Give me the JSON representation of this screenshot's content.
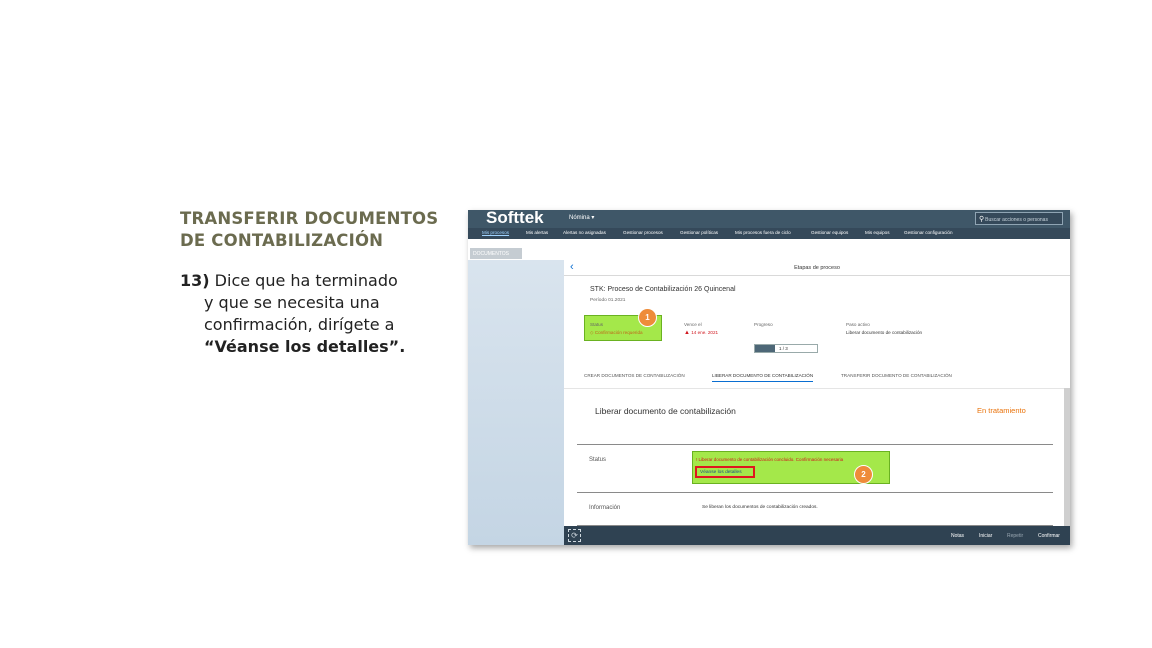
{
  "slide": {
    "title_line1": "TRANSFERIR DOCUMENTOS",
    "title_line2": "DE  CONTABILIZACIÓN",
    "step_number": "13)",
    "step_line1": "Dice que ha terminado",
    "step_line2": "y que se necesita una",
    "step_line3": "confirmación, dirígete a",
    "step_line4": "“Véanse los  detalles”."
  },
  "shell": {
    "logo": "Softtek",
    "app_menu": "Nómina ▾",
    "search_placeholder": "Buscar acciones o personas",
    "nav": [
      "Mis procesos",
      "Mis alertas",
      "Alertas no asignadas",
      "Gestionar procesos",
      "Gestionar políticas",
      "Mis procesos fuera de ciclo",
      "Gestionar equipos",
      "Mis equipos",
      "Gestionar configuración"
    ],
    "doc_tab": "DOCUMENTOS"
  },
  "panel": {
    "header_title": "Etapas de proceso",
    "object_title": "STK: Proceso de Contabilización 26 Quincenal",
    "period": "Período 01.2021",
    "status_label": "Status",
    "status_value": "Confirmación requerida",
    "due_label": "Vence el",
    "due_value": "14 ene. 2021",
    "progress_label": "Progreso",
    "progress_text": "1 / 3",
    "progress_fraction": 0.33,
    "next_step_label": "Paso activo",
    "next_step_value": "Liberar documento de contabilización",
    "tabs": [
      "CREAR DOCUMENTOS DE CONTABILIZACIÓN",
      "LIBERAR DOCUMENTO DE CONTABILIZACIÓN",
      "TRANSFERIR DOCUMENTO DE CONTABILIZACIÓN"
    ],
    "section_title": "Liberar documento de contabilización",
    "section_status": "En tratamiento",
    "row_status_label": "Status",
    "status_message": "! Liberar documento de contabilización concluido. Confirmación necesaria",
    "details_link": "Véanse los detalles",
    "row_info_label": "Información",
    "info_value": "Se liberan los documentos de contabilización creados."
  },
  "footer": {
    "buttons": [
      "Notas",
      "Iniciar",
      "Repetir",
      "Confirmar"
    ]
  },
  "badges": [
    "1",
    "2"
  ],
  "colors": {
    "shell_bar": "#3f5768",
    "highlight_green": "#a4e84a",
    "highlight_red": "#e0161e",
    "badge_orange": "#ee8c3a",
    "status_orange": "#e9730c",
    "title_olive": "#6b6b4f"
  }
}
